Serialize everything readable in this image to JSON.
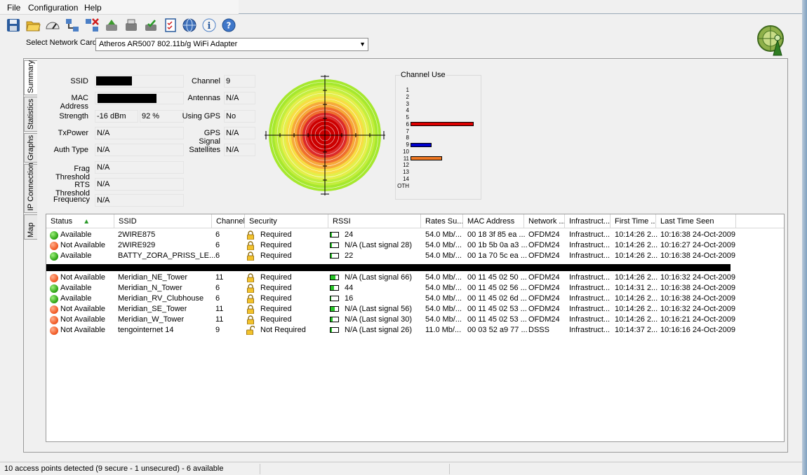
{
  "menu": [
    "File",
    "Configuration",
    "Help"
  ],
  "toolbar": {
    "icons": [
      "save-icon",
      "open-folder-icon",
      "gauge-icon",
      "connect-network-icon",
      "disconnect-network-icon",
      "scan-icon",
      "refresh-icon",
      "gps-icon",
      "checklist-icon",
      "globe-icon",
      "info-icon",
      "help-icon"
    ]
  },
  "nic": {
    "label": "Select Network Card",
    "value": "Atheros AR5007 802.11b/g WiFi Adapter"
  },
  "tabs": [
    "Summary",
    "Statistics",
    "Graphs",
    "IP Connection",
    "Map"
  ],
  "summary": {
    "ssid_label": "SSID",
    "mac_label": "MAC Address",
    "strength_label": "Strength",
    "strength_dbm": "-16 dBm",
    "strength_pct": "92 %",
    "txpower_label": "TxPower",
    "txpower": "N/A",
    "auth_label": "Auth Type",
    "auth": "N/A",
    "frag_label": "Frag Threshold",
    "frag": "N/A",
    "rts_label": "RTS Threshold",
    "rts": "N/A",
    "freq_label": "Frequency",
    "freq": "N/A",
    "channel_label": "Channel",
    "channel": "9",
    "antennas_label": "Antennas",
    "antennas": "N/A",
    "using_gps_label": "Using GPS",
    "using_gps": "No",
    "gps_signal_label": "GPS Signal",
    "gps_signal": "N/A",
    "satellites_label": "Satellites",
    "satellites": "N/A"
  },
  "chart_data": {
    "type": "bar",
    "title": "Channel Use",
    "categories": [
      "1",
      "2",
      "3",
      "4",
      "5",
      "6",
      "7",
      "8",
      "9",
      "10",
      "11",
      "12",
      "13",
      "14",
      "OTH"
    ],
    "values": [
      0,
      0,
      0,
      0,
      0,
      6,
      0,
      0,
      2,
      0,
      3,
      0,
      0,
      0,
      0
    ],
    "colors": [
      "",
      "",
      "",
      "",
      "",
      "#dd0000",
      "",
      "",
      "#0000cc",
      "",
      "#ee7722",
      "",
      "",
      "",
      ""
    ]
  },
  "table": {
    "columns": [
      "Status",
      "SSID",
      "Channel",
      "Security",
      "RSSI",
      "Rates Su...",
      "MAC Address",
      "Network ...",
      "Infrastruct...",
      "First Time ...",
      "Last Time Seen"
    ],
    "sort_indicator": "▲",
    "rows": [
      {
        "status": "Available",
        "ssid": "2WIRE875",
        "channel": "6",
        "security": "Required",
        "rssi": "24",
        "rates": "54.0 Mb/...",
        "mac": "00 18 3f 85 ea ...",
        "network": "OFDM24",
        "infra": "Infrastruct...",
        "first": "10:14:26 2...",
        "last": "10:16:38 24-Oct-2009",
        "status_color": "green",
        "locked": true,
        "rssi_fill": 0.2
      },
      {
        "status": "Not Available",
        "ssid": "2WIRE929",
        "channel": "6",
        "security": "Required",
        "rssi": "N/A (Last signal 28)",
        "rates": "54.0 Mb/...",
        "mac": "00 1b 5b 0a a3 ...",
        "network": "OFDM24",
        "infra": "Infrastruct...",
        "first": "10:14:26 2...",
        "last": "10:16:27 24-Oct-2009",
        "status_color": "red",
        "locked": true,
        "rssi_fill": 0.2
      },
      {
        "status": "Available",
        "ssid": "BATTY_ZORA_PRISS_LE...",
        "channel": "6",
        "security": "Required",
        "rssi": "22",
        "rates": "54.0 Mb/...",
        "mac": "00 1a 70 5c ea ...",
        "network": "OFDM24",
        "infra": "Infrastruct...",
        "first": "10:14:26 2...",
        "last": "10:16:38 24-Oct-2009",
        "status_color": "green",
        "locked": true,
        "rssi_fill": 0.2
      },
      {
        "status": "Not Available",
        "ssid": "Meridian_NE_Tower",
        "channel": "11",
        "security": "Required",
        "rssi": "N/A (Last signal 66)",
        "rates": "54.0 Mb/...",
        "mac": "00 11 45 02 50 ...",
        "network": "OFDM24",
        "infra": "Infrastruct...",
        "first": "10:14:26 2...",
        "last": "10:16:32 24-Oct-2009",
        "status_color": "red",
        "locked": true,
        "rssi_fill": 0.65
      },
      {
        "status": "Available",
        "ssid": "Meridian_N_Tower",
        "channel": "6",
        "security": "Required",
        "rssi": "44",
        "rates": "54.0 Mb/...",
        "mac": "00 11 45 02 56 ...",
        "network": "OFDM24",
        "infra": "Infrastruct...",
        "first": "10:14:31 2...",
        "last": "10:16:38 24-Oct-2009",
        "status_color": "green",
        "locked": true,
        "rssi_fill": 0.45
      },
      {
        "status": "Available",
        "ssid": "Meridian_RV_Clubhouse",
        "channel": "6",
        "security": "Required",
        "rssi": "16",
        "rates": "54.0 Mb/...",
        "mac": "00 11 45 02 6d ...",
        "network": "OFDM24",
        "infra": "Infrastruct...",
        "first": "10:14:26 2...",
        "last": "10:16:38 24-Oct-2009",
        "status_color": "green",
        "locked": true,
        "rssi_fill": 0.1
      },
      {
        "status": "Not Available",
        "ssid": "Meridian_SE_Tower",
        "channel": "11",
        "security": "Required",
        "rssi": "N/A (Last signal 56)",
        "rates": "54.0 Mb/...",
        "mac": "00 11 45 02 53 ...",
        "network": "OFDM24",
        "infra": "Infrastruct...",
        "first": "10:14:26 2...",
        "last": "10:16:32 24-Oct-2009",
        "status_color": "red",
        "locked": true,
        "rssi_fill": 0.55
      },
      {
        "status": "Not Available",
        "ssid": "Meridian_W_Tower",
        "channel": "11",
        "security": "Required",
        "rssi": "N/A (Last signal 30)",
        "rates": "54.0 Mb/...",
        "mac": "00 11 45 02 53 ...",
        "network": "OFDM24",
        "infra": "Infrastruct...",
        "first": "10:14:26 2...",
        "last": "10:16:21 24-Oct-2009",
        "status_color": "red",
        "locked": true,
        "rssi_fill": 0.3
      },
      {
        "status": "Not Available",
        "ssid": "tengointernet 14",
        "channel": "9",
        "security": "Not Required",
        "rssi": "N/A (Last signal 26)",
        "rates": "11.0 Mb/...",
        "mac": "00 03 52 a9 77 ...",
        "network": "DSSS",
        "infra": "Infrastruct...",
        "first": "10:14:37 2...",
        "last": "10:16:16 24-Oct-2009",
        "status_color": "red",
        "locked": false,
        "rssi_fill": 0.2
      }
    ]
  },
  "status_bar": "10 access points detected (9 secure - 1 unsecured) - 6 available",
  "colors": {
    "available": "#2fa515",
    "not_available": "#f25a24",
    "rssi_bar": "#27c427",
    "radar_center": "#cc0000",
    "radar_outer": "#a6e82e"
  }
}
